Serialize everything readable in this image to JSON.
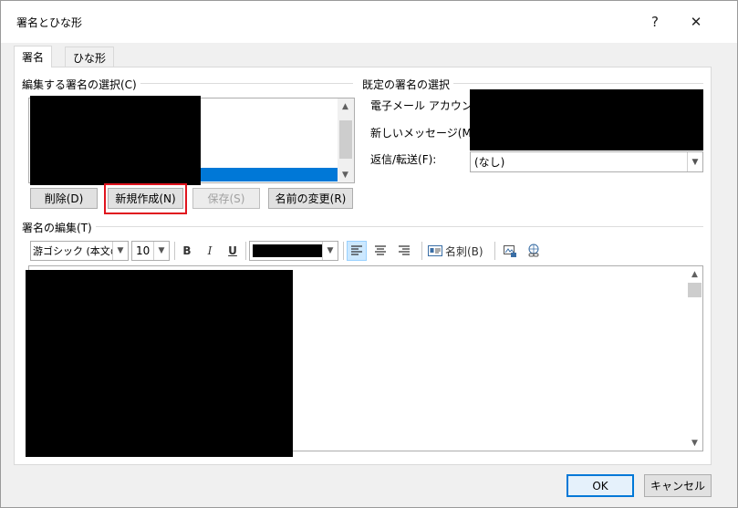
{
  "window": {
    "title": "署名とひな形",
    "help_label": "?",
    "close_label": "✕"
  },
  "tabs": [
    {
      "label": "署名"
    },
    {
      "label": "ひな形"
    }
  ],
  "select_group": {
    "label": "編集する署名の選択(C)",
    "buttons": {
      "delete": "削除(D)",
      "new": "新規作成(N)",
      "save": "保存(S)",
      "rename": "名前の変更(R)"
    }
  },
  "default_group": {
    "label": "既定の署名の選択",
    "email_account_label": "電子メール アカウント(A",
    "new_messages_label": "新しいメッセージ(M):",
    "replies_label": "返信/転送(F):",
    "replies_value": "(なし)"
  },
  "edit_group": {
    "label": "署名の編集(T)"
  },
  "toolbar": {
    "font_value": "游ゴシック (本文の",
    "size_value": "10",
    "bold": "B",
    "italic": "I",
    "underline": "U",
    "color_value": "#000000",
    "business_card_label": "名刺(B)"
  },
  "icons": {
    "scroll_up": "▲",
    "scroll_down": "▼",
    "combo_arrow": "▼"
  },
  "footer": {
    "ok_label": "OK",
    "cancel_label": "キャンセル"
  },
  "colors": {
    "selection_blue": "#0078d7",
    "highlight_red": "#e0141e",
    "redaction": "#000000"
  }
}
